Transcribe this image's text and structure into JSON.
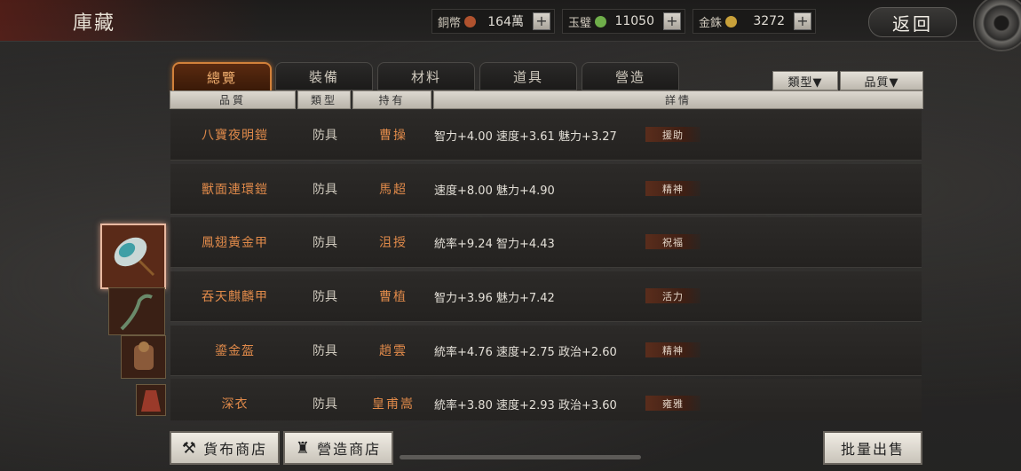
{
  "header": {
    "title": "庫藏",
    "back_label": "返回",
    "currencies": [
      {
        "label": "銅幣",
        "value": "164萬",
        "coin_color": "#b0522e"
      },
      {
        "label": "玉璧",
        "value": "11050",
        "coin_color": "#6fae4a"
      },
      {
        "label": "金銖",
        "value": "3272",
        "coin_color": "#c9a13a"
      }
    ],
    "plus_label": "+"
  },
  "tabs": [
    {
      "label": "總覽",
      "active": true
    },
    {
      "label": "裝備",
      "active": false
    },
    {
      "label": "材料",
      "active": false
    },
    {
      "label": "道具",
      "active": false
    },
    {
      "label": "營造",
      "active": false
    }
  ],
  "filters": {
    "type_label": "類型▼",
    "quality_label": "品質▼"
  },
  "columns": {
    "quality": "品質",
    "type": "類型",
    "owner": "持有",
    "details": "詳情"
  },
  "items": [
    {
      "name": "八寶夜明鎧",
      "type": "防具",
      "owner": "曹操",
      "stats": "智力+4.00  速度+3.61  魅力+3.27",
      "tag": "援助"
    },
    {
      "name": "獸面連環鎧",
      "type": "防具",
      "owner": "馬超",
      "stats": "速度+8.00  魅力+4.90",
      "tag": "精神"
    },
    {
      "name": "鳳翅黃金甲",
      "type": "防具",
      "owner": "沮授",
      "stats": "統率+9.24  智力+4.43",
      "tag": "祝福"
    },
    {
      "name": "吞天麒麟甲",
      "type": "防具",
      "owner": "曹植",
      "stats": "智力+3.96  魅力+7.42",
      "tag": "活力"
    },
    {
      "name": "鎏金盔",
      "type": "防具",
      "owner": "趙雲",
      "stats": "統率+4.76  速度+2.75  政治+2.60",
      "tag": "精神"
    },
    {
      "name": "深衣",
      "type": "防具",
      "owner": "皇甫嵩",
      "stats": "統率+3.80  速度+2.93  政治+3.60",
      "tag": "雍雅"
    }
  ],
  "bottom": {
    "coin_shop": "貨布商店",
    "build_shop": "營造商店",
    "bulk_sell": "批量出售"
  }
}
